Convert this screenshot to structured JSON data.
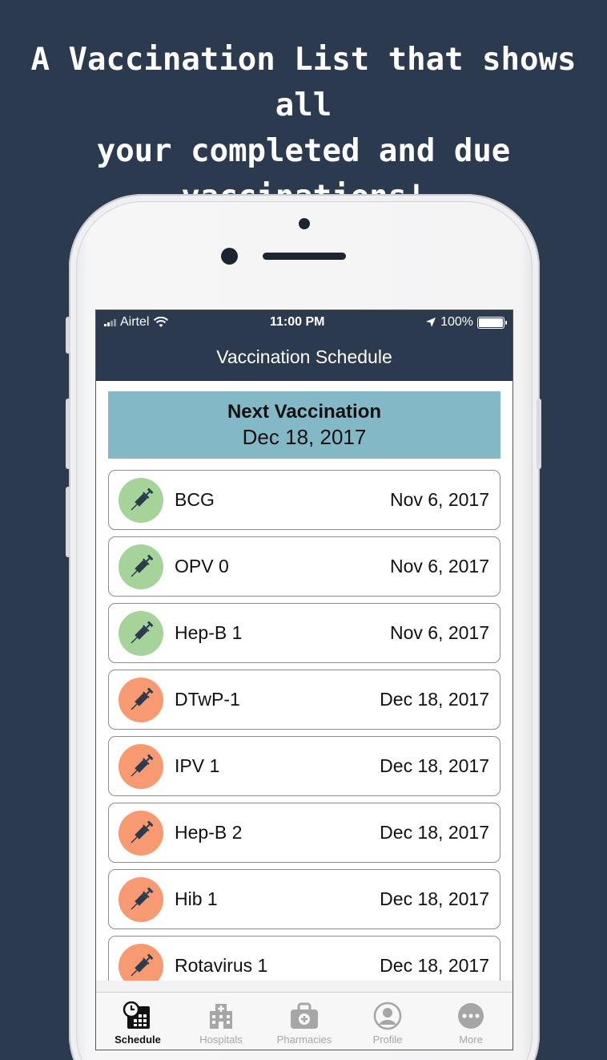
{
  "headline": {
    "line1": "A Vaccination List that shows all",
    "line2": "your completed and due",
    "line3": "vaccinations!"
  },
  "status_bar": {
    "carrier": "Airtel",
    "time": "11:00 PM",
    "battery": "100%"
  },
  "nav": {
    "title": "Vaccination Schedule"
  },
  "next_vaccination": {
    "title": "Next Vaccination",
    "date": "Dec 18, 2017"
  },
  "colors": {
    "completed": "#a5d39a",
    "due": "#f79a72",
    "header": "#2c3a50",
    "next_card": "#83b9c6"
  },
  "vaccinations": [
    {
      "name": "BCG",
      "date": "Nov 6, 2017",
      "status": "completed"
    },
    {
      "name": "OPV 0",
      "date": "Nov 6, 2017",
      "status": "completed"
    },
    {
      "name": "Hep-B 1",
      "date": "Nov 6, 2017",
      "status": "completed"
    },
    {
      "name": "DTwP-1",
      "date": "Dec 18, 2017",
      "status": "due"
    },
    {
      "name": "IPV 1",
      "date": "Dec 18, 2017",
      "status": "due"
    },
    {
      "name": "Hep-B 2",
      "date": "Dec 18, 2017",
      "status": "due"
    },
    {
      "name": "Hib 1",
      "date": "Dec 18, 2017",
      "status": "due"
    },
    {
      "name": "Rotavirus 1",
      "date": "Dec 18, 2017",
      "status": "due"
    }
  ],
  "tabs": [
    {
      "label": "Schedule",
      "icon": "calendar-clock-icon",
      "active": true
    },
    {
      "label": "Hospitals",
      "icon": "hospital-icon",
      "active": false
    },
    {
      "label": "Pharmacies",
      "icon": "medical-bag-icon",
      "active": false
    },
    {
      "label": "Profile",
      "icon": "profile-icon",
      "active": false
    },
    {
      "label": "More",
      "icon": "more-icon",
      "active": false
    }
  ]
}
